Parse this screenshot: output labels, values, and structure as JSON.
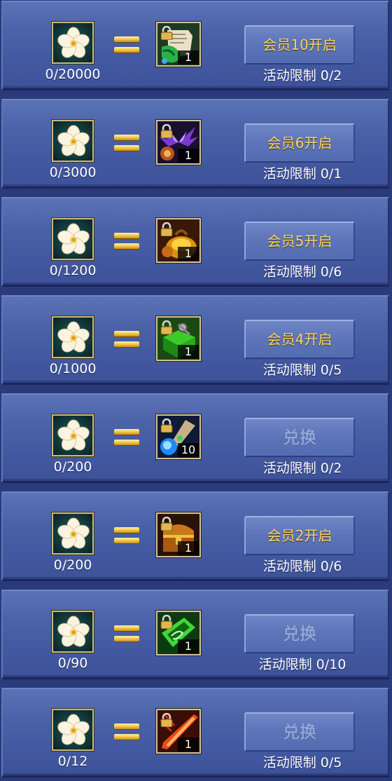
{
  "currency": {
    "icon": "white-flower-icon"
  },
  "rows": [
    {
      "cost": "0/20000",
      "item_icon": "scroll-map-icon",
      "item_qty": "1",
      "button": "会员10开启",
      "button_kind": "vip",
      "limit": "活动限制 0/2"
    },
    {
      "cost": "0/3000",
      "item_icon": "purple-wing-icon",
      "item_qty": "1",
      "button": "会员6开启",
      "button_kind": "vip",
      "limit": "活动限制 0/1"
    },
    {
      "cost": "0/1200",
      "item_icon": "gold-pouch-icon",
      "item_qty": "1",
      "button": "会员5开启",
      "button_kind": "vip",
      "limit": "活动限制 0/6"
    },
    {
      "cost": "0/1000",
      "item_icon": "green-gear-box-icon",
      "item_qty": "1",
      "button": "会员4开启",
      "button_kind": "vip",
      "limit": "活动限制 0/5"
    },
    {
      "cost": "0/200",
      "item_icon": "blue-potion-icon",
      "item_qty": "10",
      "button": "兑换",
      "button_kind": "exchange",
      "limit": "活动限制 0/2"
    },
    {
      "cost": "0/200",
      "item_icon": "treasure-chest-icon",
      "item_qty": "1",
      "button": "会员2开启",
      "button_kind": "vip",
      "limit": "活动限制 0/6"
    },
    {
      "cost": "0/90",
      "item_icon": "green-crystal-icon",
      "item_qty": "1",
      "button": "兑换",
      "button_kind": "exchange",
      "limit": "活动限制 0/10"
    },
    {
      "cost": "0/12",
      "item_icon": "red-blade-icon",
      "item_qty": "1",
      "button": "兑换",
      "button_kind": "exchange",
      "limit": "活动限制 0/5"
    }
  ]
}
